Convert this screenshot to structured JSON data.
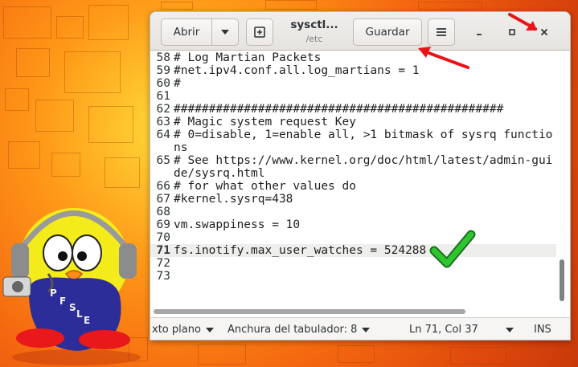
{
  "header": {
    "open_label": "Abrir",
    "title": "sysctl...",
    "subtitle": "/etc",
    "save_label": "Guardar"
  },
  "icons": {
    "open_menu": "chevron-down-icon",
    "new_document": "new-document-icon",
    "menu": "hamburger-menu-icon",
    "minimize": "minimize-icon",
    "maximize": "maximize-icon",
    "close": "close-icon"
  },
  "editor": {
    "current_line": "71",
    "lines": [
      {
        "n": "58",
        "text": "# Log Martian Packets"
      },
      {
        "n": "59",
        "text": "#net.ipv4.conf.all.log_martians = 1"
      },
      {
        "n": "60",
        "text": "#"
      },
      {
        "n": "61",
        "text": ""
      },
      {
        "n": "62",
        "text": "###############################################"
      },
      {
        "n": "63",
        "text": "# Magic system request Key"
      },
      {
        "n": "64",
        "text": "# 0=disable, 1=enable all, >1 bitmask of sysrq functions"
      },
      {
        "n": "65",
        "text": "# See https://www.kernel.org/doc/html/latest/admin-guide/sysrq.html"
      },
      {
        "n": "66",
        "text": "# for what other values do"
      },
      {
        "n": "67",
        "text": "#kernel.sysrq=438"
      },
      {
        "n": "68",
        "text": ""
      },
      {
        "n": "69",
        "text": "vm.swappiness = 10"
      },
      {
        "n": "70",
        "text": ""
      },
      {
        "n": "71",
        "text": "fs.inotify.max_user_watches = 524288"
      },
      {
        "n": "72",
        "text": ""
      },
      {
        "n": "73",
        "text": ""
      }
    ]
  },
  "statusbar": {
    "language": "xto plano",
    "tab_width": "Anchura del tabulador: 8",
    "position": "Ln 71, Col 37",
    "mode": "INS"
  },
  "mascot": {
    "letters": [
      "P",
      "F",
      "S",
      "L",
      "E"
    ]
  },
  "annotations": {
    "arrow_color": "#e8141b",
    "check_color": "#1fb21f"
  }
}
